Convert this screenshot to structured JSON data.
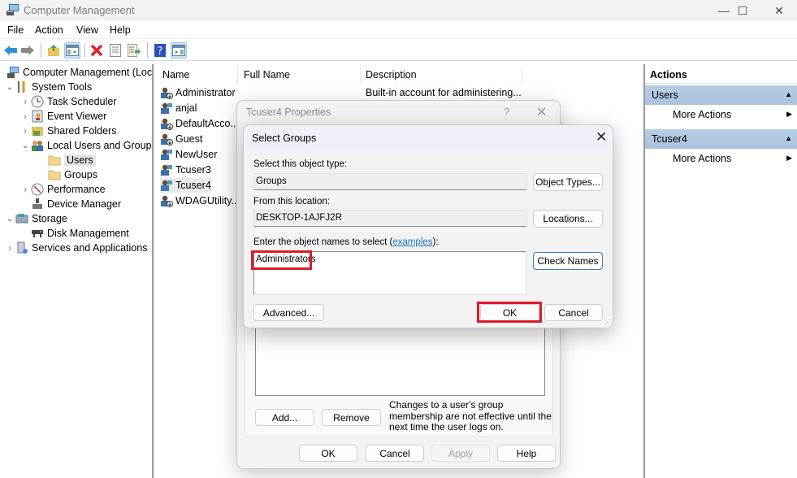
{
  "window": {
    "title": "Computer Management",
    "controls": {
      "minimize": "—",
      "maximize": "☐",
      "close": "✕"
    }
  },
  "menu": [
    "File",
    "Action",
    "View",
    "Help"
  ],
  "toolbar": {
    "icons": [
      "back-arrow-icon",
      "forward-arrow-icon",
      "up-folder-icon",
      "show-hide-tree-icon",
      "delete-icon",
      "properties-icon",
      "export-list-icon",
      "help-icon",
      "show-hide-action-pane-icon"
    ]
  },
  "tree": [
    {
      "label": "Computer Management (Local",
      "chev": "",
      "icon": "computer-management-icon",
      "level": 0
    },
    {
      "label": "System Tools",
      "chev": "⌄",
      "icon": "system-tools-icon",
      "level": 1
    },
    {
      "label": "Task Scheduler",
      "chev": "›",
      "icon": "task-scheduler-icon",
      "level": 2
    },
    {
      "label": "Event Viewer",
      "chev": "›",
      "icon": "event-viewer-icon",
      "level": 2
    },
    {
      "label": "Shared Folders",
      "chev": "›",
      "icon": "shared-folders-icon",
      "level": 2
    },
    {
      "label": "Local Users and Groups",
      "chev": "⌄",
      "icon": "local-users-groups-icon",
      "level": 2
    },
    {
      "label": "Users",
      "chev": "",
      "icon": "folder-icon",
      "level": 3,
      "selected": true
    },
    {
      "label": "Groups",
      "chev": "",
      "icon": "folder-icon",
      "level": 3
    },
    {
      "label": "Performance",
      "chev": "›",
      "icon": "performance-icon",
      "level": 2
    },
    {
      "label": "Device Manager",
      "chev": "",
      "icon": "device-manager-icon",
      "level": 2
    },
    {
      "label": "Storage",
      "chev": "⌄",
      "icon": "storage-icon",
      "level": 1
    },
    {
      "label": "Disk Management",
      "chev": "",
      "icon": "disk-management-icon",
      "level": 2
    },
    {
      "label": "Services and Applications",
      "chev": "›",
      "icon": "services-applications-icon",
      "level": 1
    }
  ],
  "list": {
    "columns": [
      "Name",
      "Full Name",
      "Description"
    ],
    "rows": [
      {
        "name": "Administrator",
        "full_name": "",
        "description": "Built-in account for administering...",
        "disabled": true
      },
      {
        "name": "anjal",
        "full_name": "",
        "description": "",
        "disabled": false
      },
      {
        "name": "DefaultAcco...",
        "full_name": "",
        "description": "",
        "disabled": true
      },
      {
        "name": "Guest",
        "full_name": "",
        "description": "",
        "disabled": true
      },
      {
        "name": "NewUser",
        "full_name": "",
        "description": "",
        "disabled": false
      },
      {
        "name": "Tcuser3",
        "full_name": "",
        "description": "",
        "disabled": false
      },
      {
        "name": "Tcuser4",
        "full_name": "",
        "description": "",
        "disabled": false,
        "selected": true
      },
      {
        "name": "WDAGUtility...",
        "full_name": "",
        "description": "",
        "disabled": true
      }
    ]
  },
  "actions": {
    "header": "Actions",
    "groups": [
      {
        "title": "Users",
        "items": [
          "More Actions"
        ]
      },
      {
        "title": "Tcuser4",
        "items": [
          "More Actions"
        ]
      }
    ]
  },
  "properties_dialog": {
    "title": "Tcuser4 Properties",
    "help": "?",
    "close": "✕",
    "add_label": "Add...",
    "remove_label": "Remove",
    "note": "Changes to a user's group membership are not effective until the next time the user logs on.",
    "ok_label": "OK",
    "cancel_label": "Cancel",
    "apply_label": "Apply",
    "help_label": "Help"
  },
  "select_groups_dialog": {
    "title": "Select Groups",
    "close": "✕",
    "object_type_label": "Select this object type:",
    "object_type_value": "Groups",
    "object_types_button": "Object Types...",
    "location_label": "From this location:",
    "location_value": "DESKTOP-1AJFJ2R",
    "locations_button": "Locations...",
    "names_label_prefix": "Enter the object names to select (",
    "names_label_link": "examples",
    "names_label_suffix": "):",
    "names_value": "Administrators",
    "check_names_button": "Check Names",
    "advanced_button": "Advanced...",
    "ok_button": "OK",
    "cancel_button": "Cancel",
    "highlight_color": "#e0192a"
  }
}
